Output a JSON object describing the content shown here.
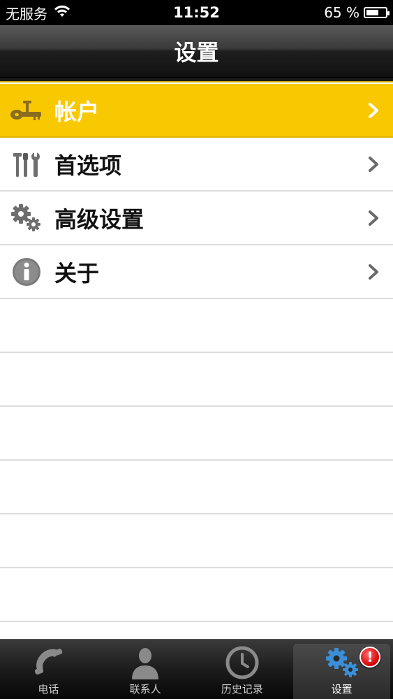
{
  "status_bar": {
    "carrier": "无服务",
    "time": "11:52",
    "battery_percent": "65 %",
    "battery_level": 0.65,
    "wifi_icon": "wifi-icon"
  },
  "nav": {
    "title": "设置"
  },
  "list": {
    "items": [
      {
        "label": "帐户",
        "icon": "key-icon",
        "selected": true
      },
      {
        "label": "首选项",
        "icon": "tools-icon",
        "selected": false
      },
      {
        "label": "高级设置",
        "icon": "gears-icon",
        "selected": false
      },
      {
        "label": "关于",
        "icon": "info-icon",
        "selected": false
      }
    ]
  },
  "tabbar": {
    "tabs": [
      {
        "label": "电话",
        "icon": "phone-icon"
      },
      {
        "label": "联系人",
        "icon": "contact-icon"
      },
      {
        "label": "历史记录",
        "icon": "clock-icon"
      },
      {
        "label": "设置",
        "icon": "settings-gears-icon",
        "active": true,
        "badge": "!"
      }
    ]
  },
  "colors": {
    "selected_row": "#f8c800",
    "nav_bg": "#2a2a2a",
    "accent_blue": "#3a8fd8",
    "badge_red": "#d40000"
  }
}
